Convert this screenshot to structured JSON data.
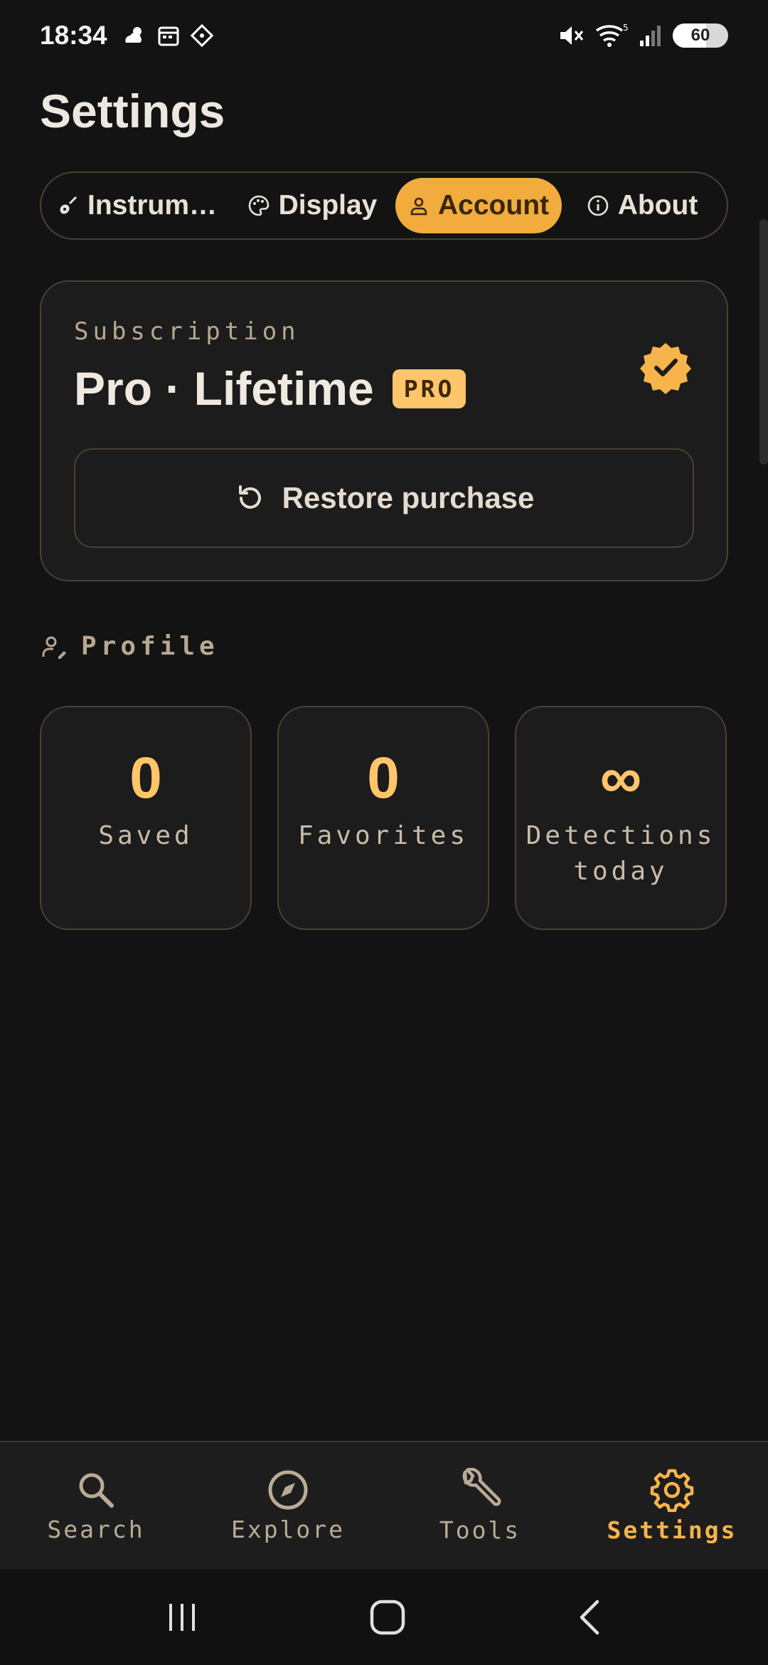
{
  "status_bar": {
    "time": "18:34",
    "battery": "60",
    "icons": [
      "weather-icon",
      "calendar-icon",
      "app-icon",
      "mute-icon",
      "wifi-icon",
      "signal-icon",
      "battery-icon"
    ]
  },
  "page": {
    "title": "Settings"
  },
  "tabs": [
    {
      "label": "Instrum…",
      "icon": "guitar-icon",
      "active": false
    },
    {
      "label": "Display",
      "icon": "palette-icon",
      "active": false
    },
    {
      "label": "Account",
      "icon": "person-icon",
      "active": true
    },
    {
      "label": "About",
      "icon": "info-icon",
      "active": false
    }
  ],
  "subscription": {
    "label": "Subscription",
    "plan": "Pro · Lifetime",
    "badge": "PRO",
    "restore_label": "Restore purchase"
  },
  "profile": {
    "heading": "Profile",
    "stats": [
      {
        "value": "0",
        "label": "Saved"
      },
      {
        "value": "0",
        "label": "Favorites"
      },
      {
        "value": "∞",
        "label": "Detections today"
      }
    ]
  },
  "bottom_nav": [
    {
      "label": "Search",
      "icon": "search-icon",
      "active": false
    },
    {
      "label": "Explore",
      "icon": "compass-icon",
      "active": false
    },
    {
      "label": "Tools",
      "icon": "wrench-icon",
      "active": false
    },
    {
      "label": "Settings",
      "icon": "gear-icon",
      "active": true
    }
  ],
  "colors": {
    "background": "#131313",
    "accent": "#f1ac3d",
    "accent_text": "#ffc56a",
    "border": "#4a4034"
  }
}
